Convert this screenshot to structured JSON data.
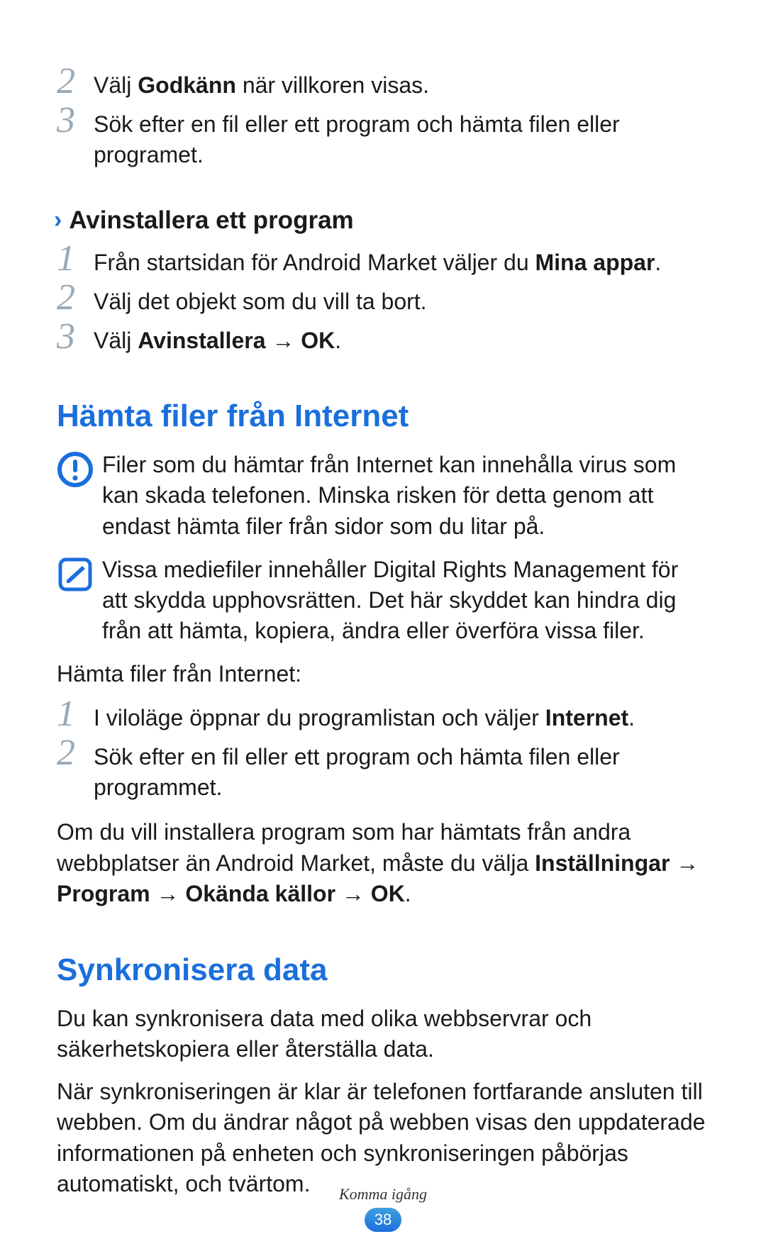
{
  "continued_steps": [
    {
      "num": "2",
      "text_pre": "Välj ",
      "bold1": "Godkänn",
      "text_post": " när villkoren visas."
    },
    {
      "num": "3",
      "text_pre": "Sök efter en fil eller ett program och hämta filen eller programet.",
      "bold1": "",
      "text_post": ""
    }
  ],
  "uninstall": {
    "heading": "Avinstallera ett program",
    "steps": [
      {
        "num": "1",
        "text_pre": "Från startsidan för Android Market väljer du ",
        "bold1": "Mina appar",
        "text_post": "."
      },
      {
        "num": "2",
        "text_pre": "Välj det objekt som du vill ta bort.",
        "bold1": "",
        "text_post": ""
      },
      {
        "num": "3",
        "text_pre": "Välj ",
        "bold1": "Avinstallera",
        "text_mid": " → ",
        "bold2": "OK",
        "text_post": "."
      }
    ]
  },
  "download": {
    "heading": "Hämta filer från Internet",
    "warning": "Filer som du hämtar från Internet kan innehålla virus som kan skada telefonen. Minska risken för detta genom att endast hämta filer från sidor som du litar på.",
    "drm": "Vissa mediefiler innehåller Digital Rights Management för att skydda upphovsrätten. Det här skyddet kan hindra dig från att hämta, kopiera, ändra eller överföra vissa filer.",
    "intro": "Hämta filer från Internet:",
    "steps": [
      {
        "num": "1",
        "text_pre": "I viloläge öppnar du programlistan och väljer ",
        "bold1": "Internet",
        "text_post": "."
      },
      {
        "num": "2",
        "text_pre": "Sök efter en fil eller ett program och hämta filen eller programmet.",
        "bold1": "",
        "text_post": ""
      }
    ],
    "install_pre": "Om du vill installera program som har hämtats från andra webbplatser än Android Market, måste du välja ",
    "install_bold": "Inställningar → Program → Okända källor → OK",
    "install_post": "."
  },
  "sync": {
    "heading": "Synkronisera data",
    "p1": "Du kan synkronisera data med olika webbservrar och säkerhetskopiera eller återställa data.",
    "p2": "När synkroniseringen är klar är telefonen fortfarande ansluten till webben. Om du ändrar något på webben visas den uppdaterade informationen på enheten och synkroniseringen påbörjas automatiskt, och tvärtom."
  },
  "footer": {
    "chapter": "Komma igång",
    "page": "38"
  }
}
